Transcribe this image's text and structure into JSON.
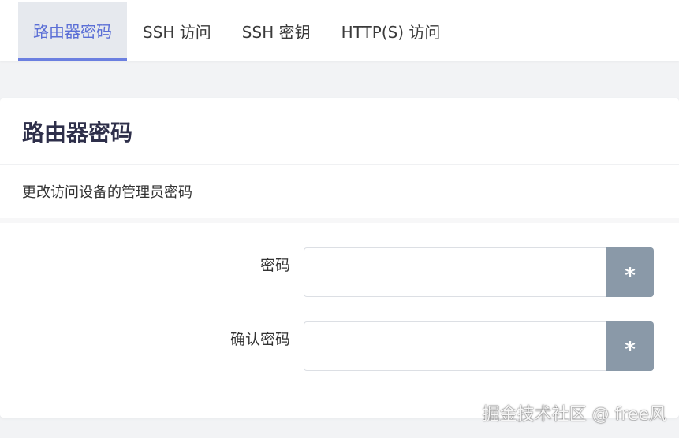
{
  "tabs": [
    {
      "label": "路由器密码",
      "active": true
    },
    {
      "label": "SSH 访问",
      "active": false
    },
    {
      "label": "SSH 密钥",
      "active": false
    },
    {
      "label": "HTTP(S) 访问",
      "active": false
    }
  ],
  "section": {
    "title": "路由器密码",
    "description": "更改访问设备的管理员密码"
  },
  "fields": {
    "password": {
      "label": "密码",
      "value": "",
      "reveal_glyph": "*"
    },
    "confirm": {
      "label": "确认密码",
      "value": "",
      "reveal_glyph": "*"
    }
  },
  "watermark": "掘金技术社区 @ free风",
  "colors": {
    "accent": "#5b6fd6",
    "active_tab_bg": "#e6e9ee",
    "reveal_button": "#8a99a8",
    "title": "#2e2f4a"
  }
}
